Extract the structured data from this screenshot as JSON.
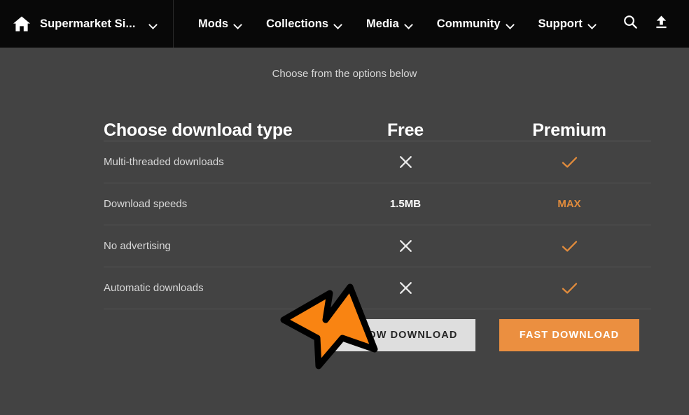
{
  "navbar": {
    "home_icon": "home-icon",
    "game_title": "Supermarket Si...",
    "game_caret": "chevron-down-icon",
    "links": [
      {
        "label": "Mods",
        "caret": "chevron-down-icon"
      },
      {
        "label": "Collections",
        "caret": "chevron-down-icon"
      },
      {
        "label": "Media",
        "caret": "chevron-down-icon"
      },
      {
        "label": "Community",
        "caret": "chevron-down-icon"
      },
      {
        "label": "Support",
        "caret": "chevron-down-icon"
      }
    ],
    "search_icon": "search-icon",
    "upload_icon": "upload-icon"
  },
  "main": {
    "subtitle": "Choose from the options below",
    "table": {
      "headers": {
        "feature": "Choose download type",
        "free": "Free",
        "premium": "Premium"
      },
      "rows": [
        {
          "feature": "Multi-threaded downloads",
          "free": "✕",
          "free_type": "cross",
          "premium": "✓",
          "premium_type": "check"
        },
        {
          "feature": "Download speeds",
          "free": "1.5MB",
          "free_type": "text",
          "premium": "MAX",
          "premium_type": "text"
        },
        {
          "feature": "No advertising",
          "free": "✕",
          "free_type": "cross",
          "premium": "✓",
          "premium_type": "check"
        },
        {
          "feature": "Automatic downloads",
          "free": "✕",
          "free_type": "cross",
          "premium": "✓",
          "premium_type": "check"
        }
      ]
    },
    "buttons": {
      "slow": "SLOW DOWNLOAD",
      "fast": "FAST DOWNLOAD"
    }
  },
  "annotation": {
    "arrow": "arrow-pointing-down-right",
    "target": "SLOW DOWNLOAD"
  },
  "colors": {
    "page_bg": "#434343",
    "navbar_bg": "#080808",
    "accent_orange": "#e08b3c",
    "fast_button": "#eb8f40",
    "slow_button": "#dedede",
    "annotation_orange": "#f98412",
    "annotation_outline": "#000000",
    "check_orange": "#e08b3c",
    "cross_white": "#e9e9e9"
  }
}
